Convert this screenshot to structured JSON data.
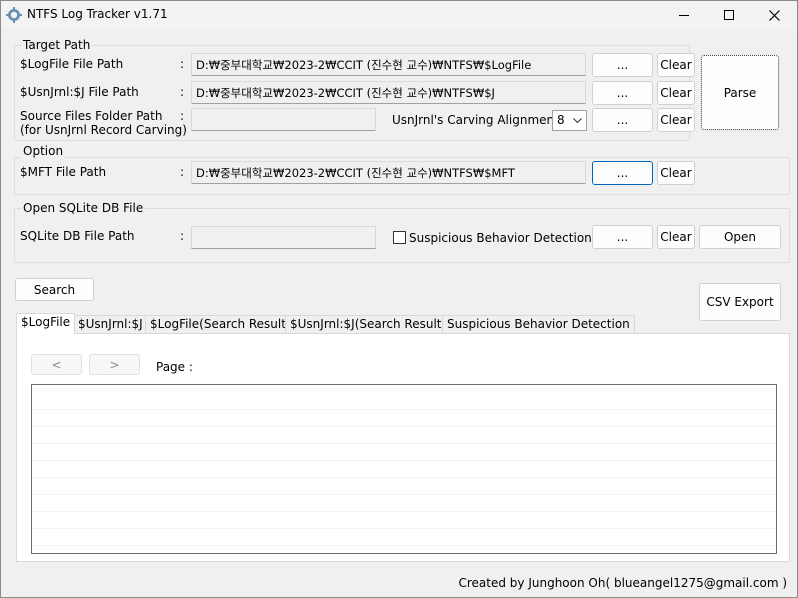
{
  "window": {
    "title": "NTFS Log Tracker v1.71",
    "icon": "gear-icon",
    "controls": [
      "minimize-icon",
      "maximize-icon",
      "close-icon"
    ]
  },
  "target_path": {
    "group_label": "Target Path",
    "logfile_label": "$LogFile File Path",
    "logfile_value": "D:₩중부대학교₩2023-2₩CCIT (진수현 교수)₩NTFS₩$LogFile",
    "usnjrnl_label": "$UsnJrnl:$J File Path",
    "usnjrnl_value": "D:₩중부대학교₩2023-2₩CCIT (진수현 교수)₩NTFS₩$J",
    "source_label_line1": "Source Files Folder Path",
    "source_label_line2": "(for UsnJrnl Record Carving)",
    "source_value": "",
    "carving_label": "UsnJrnl's Carving Alignment :",
    "carving_value": "8",
    "colon": ":",
    "browse_label": "...",
    "clear_label": "Clear",
    "parse_label": "Parse"
  },
  "option": {
    "group_label": "Option",
    "mft_label": "$MFT File Path",
    "mft_value": "D:₩중부대학교₩2023-2₩CCIT (진수현 교수)₩NTFS₩$MFT",
    "browse_label": "...",
    "clear_label": "Clear"
  },
  "sqlite": {
    "group_label": "Open SQLite DB File",
    "db_label": "SQLite DB File Path",
    "db_value": "",
    "suspicious_label": "Suspicious Behavior Detection",
    "browse_label": "...",
    "clear_label": "Clear",
    "open_label": "Open"
  },
  "actions": {
    "search_label": "Search",
    "csv_label": "CSV Export"
  },
  "tabs": [
    {
      "label": "$LogFile",
      "active": true
    },
    {
      "label": "$UsnJrnl:$J",
      "active": false
    },
    {
      "label": "$LogFile(Search Result)",
      "active": false
    },
    {
      "label": "$UsnJrnl:$J(Search Result)",
      "active": false
    },
    {
      "label": "Suspicious Behavior Detection",
      "active": false
    }
  ],
  "pager": {
    "prev_label": "<",
    "next_label": ">",
    "page_label": "Page :"
  },
  "footer": {
    "credit": "Created by Junghoon Oh( blueangel1275@gmail.com )"
  }
}
